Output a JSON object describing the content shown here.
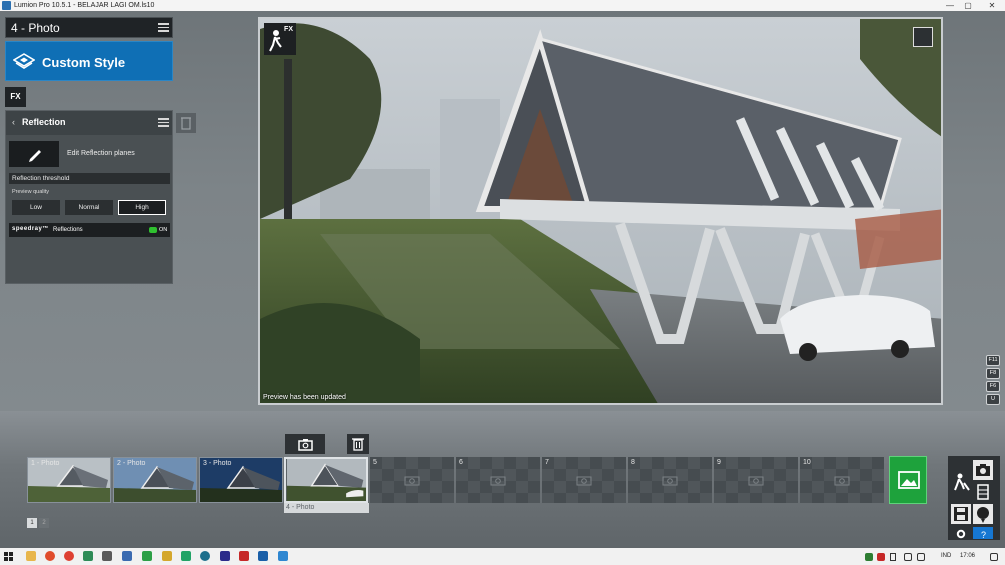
{
  "titlebar": {
    "title": "Lumion Pro 10.5.1  - BELAJAR LAGI OM.ls10",
    "minimize": "—",
    "maximize": "▢",
    "close": "✕"
  },
  "mode": {
    "title": "4 - Photo"
  },
  "style_button": {
    "label": "Custom Style"
  },
  "fx_button": {
    "label": "FX"
  },
  "effect_panel": {
    "back_icon": "‹",
    "title": "Reflection",
    "edit_label": "Edit Reflection planes",
    "threshold_label": "Reflection threshold",
    "preview_quality_label": "Preview quality",
    "quality_options": [
      "Low",
      "Normal",
      "High"
    ],
    "quality_selected": "High",
    "speedray_label": "speedray™",
    "reflections_label": "Reflections",
    "toggle_state": "ON"
  },
  "viewport": {
    "fx_label": "FX",
    "status": "Preview has been updated"
  },
  "function_keys": [
    "F11",
    "F8",
    "F6",
    "U"
  ],
  "filmstrip": {
    "slots": [
      {
        "number": "1 - Photo",
        "filled": true
      },
      {
        "number": "2 - Photo",
        "filled": true
      },
      {
        "number": "3 - Photo",
        "filled": true
      },
      {
        "number": "",
        "filled": true,
        "active": true
      },
      {
        "number": "5",
        "filled": false
      },
      {
        "number": "6",
        "filled": false
      },
      {
        "number": "7",
        "filled": false
      },
      {
        "number": "8",
        "filled": false
      },
      {
        "number": "9",
        "filled": false
      },
      {
        "number": "10",
        "filled": false
      }
    ],
    "active_caption": "4 - Photo",
    "pages": [
      "1",
      "2"
    ]
  },
  "taskbar": {
    "tray_lang": "IND",
    "time": "17:06"
  },
  "colors": {
    "accent_blue": "#0f6fb5",
    "render_green": "#1ea23c",
    "toggle_on": "#2fc12f"
  }
}
